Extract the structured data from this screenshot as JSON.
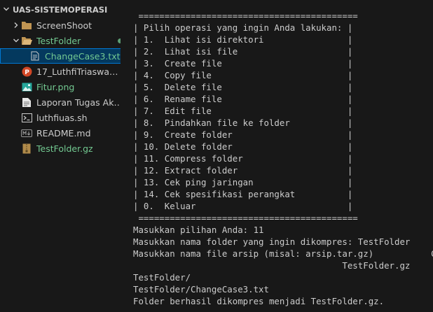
{
  "explorer": {
    "workspace_title": "UAS-SISTEMOPERASI",
    "items": [
      {
        "label": "ScreenShoot",
        "status": ""
      },
      {
        "label": "TestFolder",
        "status": ""
      },
      {
        "label": "ChangeCase3.txt",
        "status": "U"
      },
      {
        "label": "17_LuthfiTriaswangga_...",
        "status": ""
      },
      {
        "label": "Fitur.png",
        "status": "U"
      },
      {
        "label": "Laporan Tugas Akhir...",
        "status": ""
      },
      {
        "label": "luthfiuas.sh",
        "status": ""
      },
      {
        "label": "README.md",
        "status": ""
      },
      {
        "label": "TestFolder.gz",
        "status": "U"
      }
    ]
  },
  "terminal": {
    "lines": [
      " ==========================================",
      "| Pilih operasi yang ingin Anda lakukan: |",
      "| 1.  Lihat isi direktori                |",
      "| 2.  Lihat isi file                     |",
      "| 3.  Create file                        |",
      "| 4.  Copy file                          |",
      "| 5.  Delete file                        |",
      "| 6.  Rename file                        |",
      "| 7.  Edit file                          |",
      "| 8.  Pindahkan file ke folder           |",
      "| 9.  Create folder                      |",
      "| 10. Delete folder                      |",
      "| 11. Compress folder                    |",
      "| 12. Extract folder                     |",
      "| 13. Cek ping jaringan                  |",
      "| 14. Cek spesifikasi perangkat          |",
      "| 0.  Keluar                             |",
      " ==========================================",
      "Masukkan pilihan Anda: 11",
      "Masukkan nama folder yang ingin dikompres: TestFolder",
      "Masukkan nama file arsip (misal: arsip.tar.gz)           G",
      "                                        TestFolder.gz",
      "",
      "TestFolder/",
      "TestFolder/ChangeCase3.txt",
      "Folder berhasil dikompres menjadi TestFolder.gz."
    ]
  }
}
